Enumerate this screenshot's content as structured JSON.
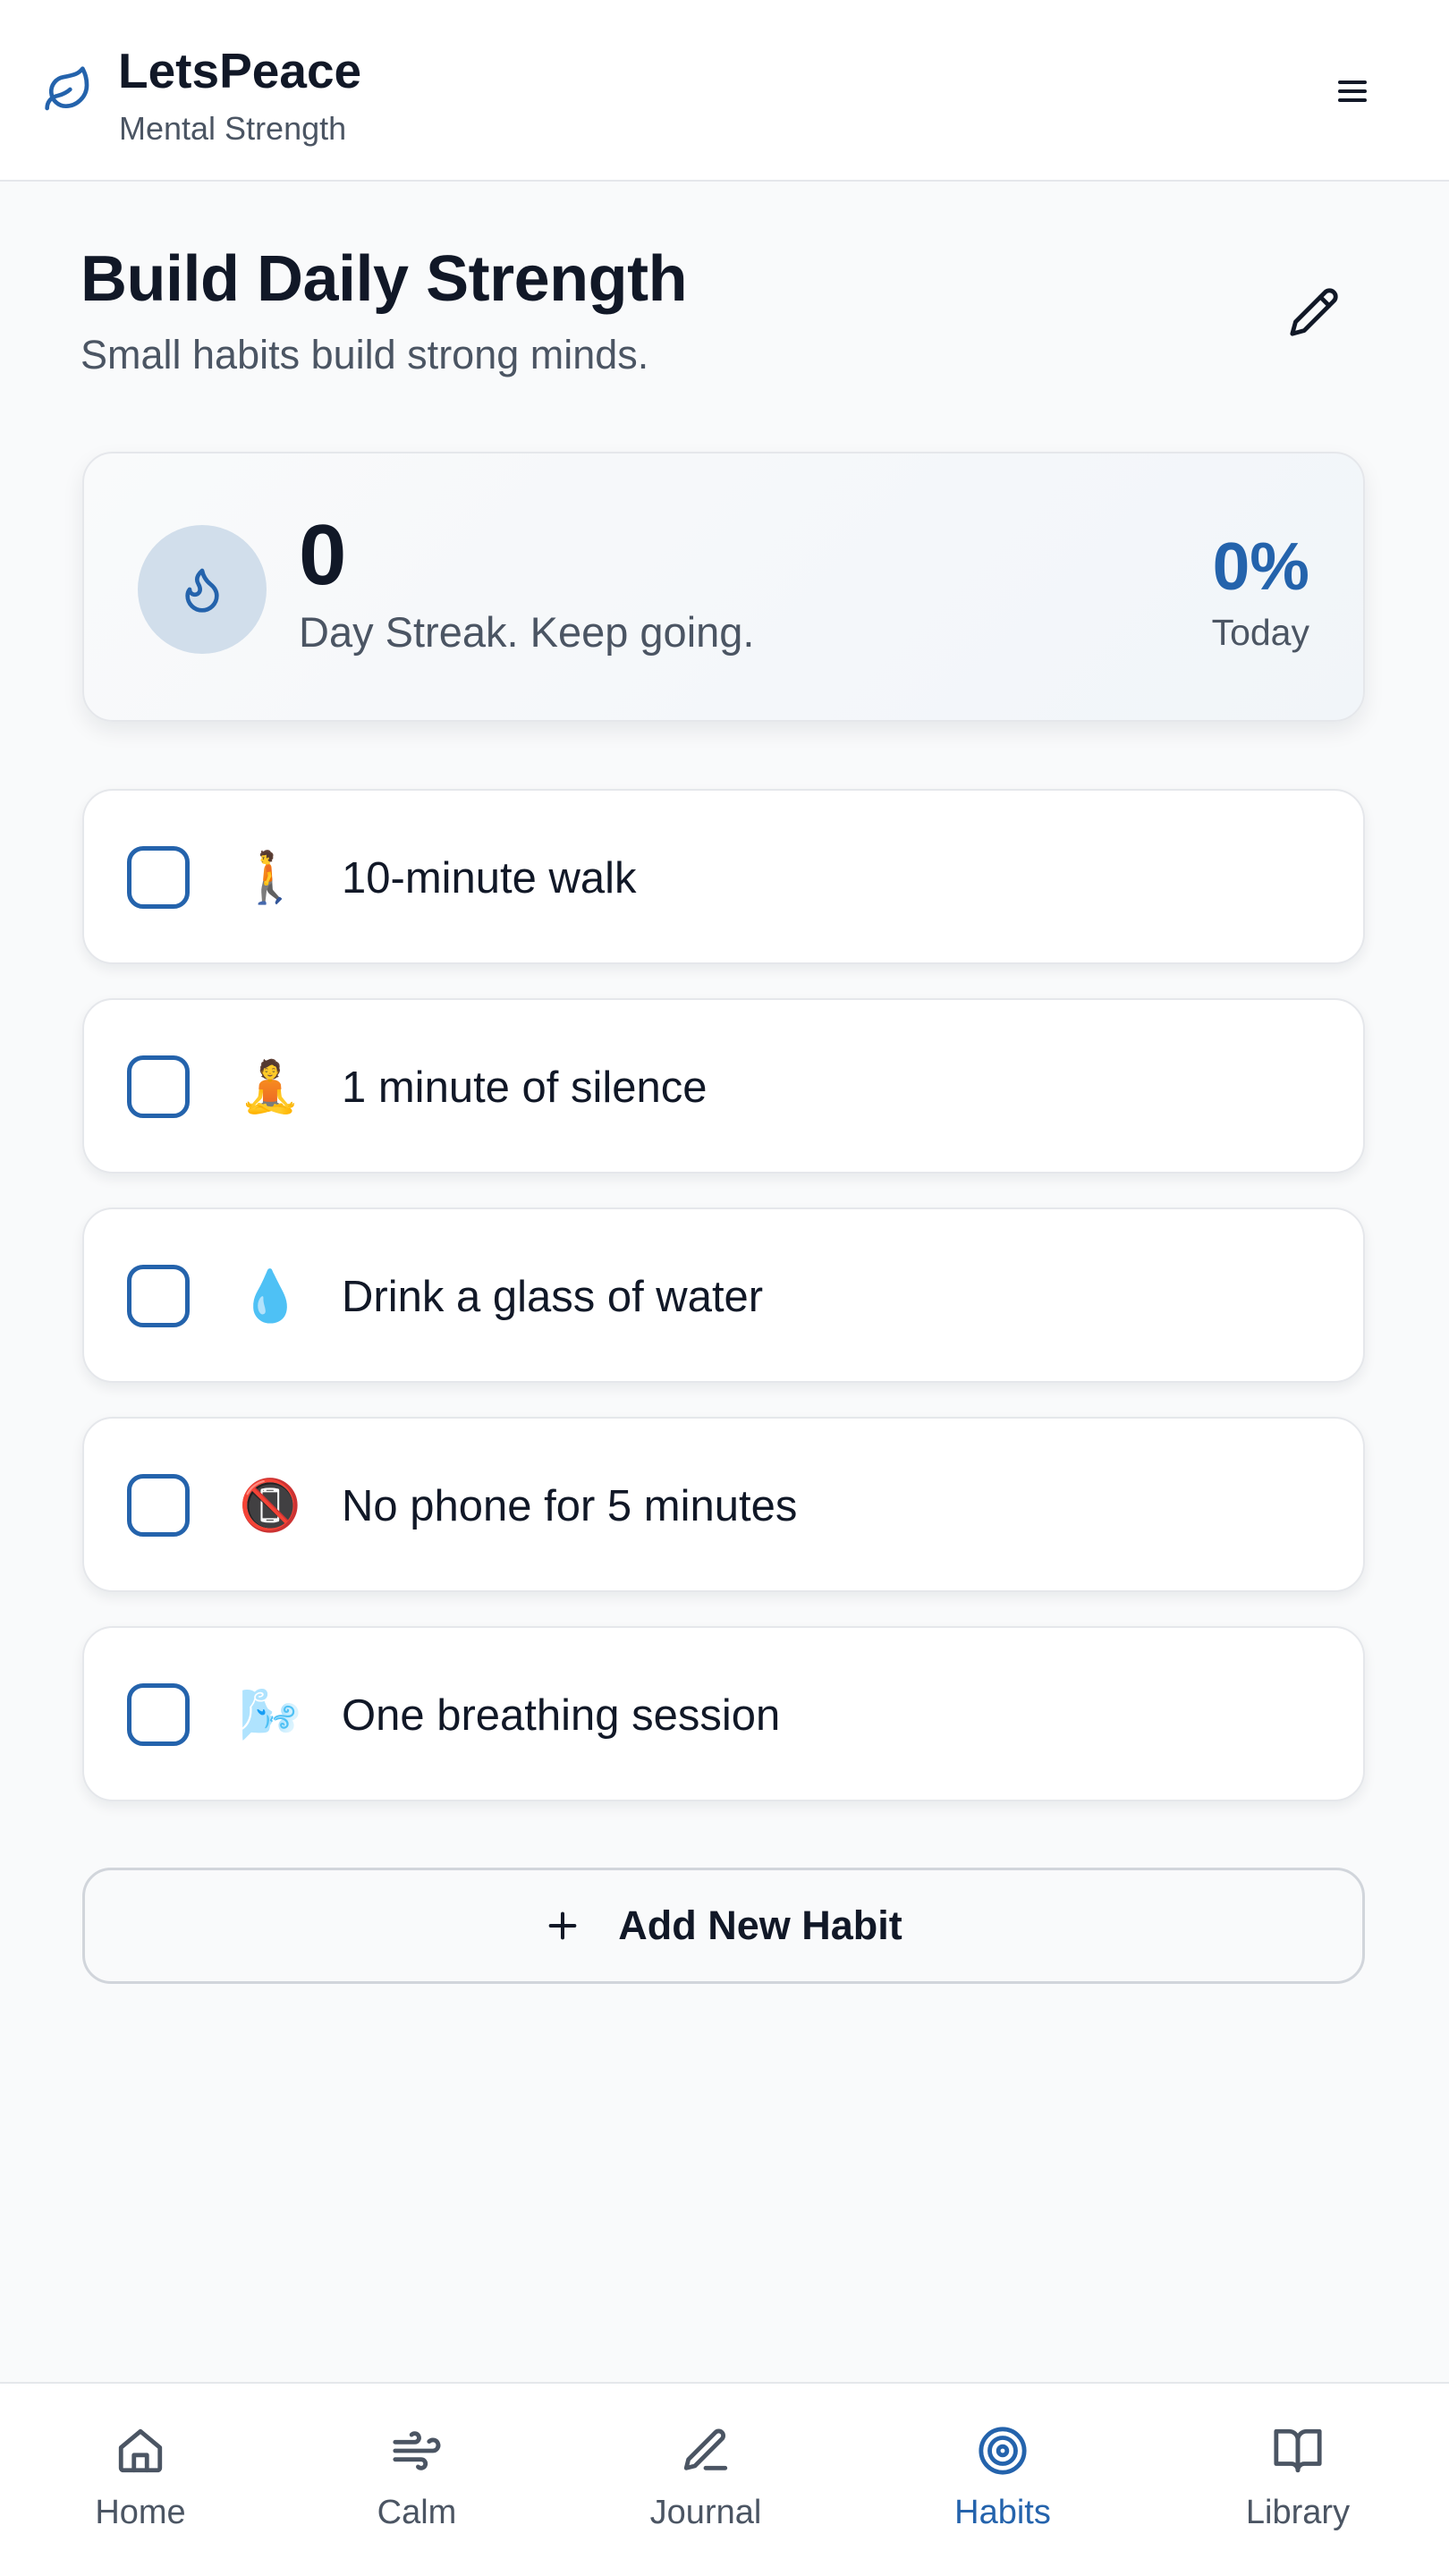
{
  "header": {
    "app_name": "LetsPeace",
    "app_subtitle": "Mental Strength",
    "logo_icon": "leaf-icon",
    "menu_icon": "hamburger-menu-icon"
  },
  "page": {
    "title": "Build Daily Strength",
    "subtitle": "Small habits build strong minds.",
    "edit_icon": "pencil-icon"
  },
  "streak": {
    "icon": "flame-icon",
    "days": "0",
    "text": "Day Streak. Keep going.",
    "today_percent": "0%",
    "today_label": "Today"
  },
  "habits": [
    {
      "emoji": "🚶",
      "label": "10-minute walk",
      "checked": false
    },
    {
      "emoji": "🧘",
      "label": "1 minute of silence",
      "checked": false
    },
    {
      "emoji": "💧",
      "label": "Drink a glass of water",
      "checked": false
    },
    {
      "emoji": "📵",
      "label": "No phone for 5 minutes",
      "checked": false
    },
    {
      "emoji": "🌬️",
      "label": "One breathing session",
      "checked": false
    }
  ],
  "add_habit": {
    "label": "Add New Habit",
    "icon": "plus-icon"
  },
  "nav": {
    "active": "Habits",
    "items": [
      {
        "label": "Home",
        "icon": "home-icon"
      },
      {
        "label": "Calm",
        "icon": "wind-icon"
      },
      {
        "label": "Journal",
        "icon": "pen-icon"
      },
      {
        "label": "Habits",
        "icon": "target-icon"
      },
      {
        "label": "Library",
        "icon": "book-icon"
      }
    ]
  },
  "colors": {
    "accent": "#2463ac",
    "text": "#111827",
    "muted": "#4b5563",
    "background": "#f9fafb",
    "flame_circle": "#d1deeb"
  }
}
